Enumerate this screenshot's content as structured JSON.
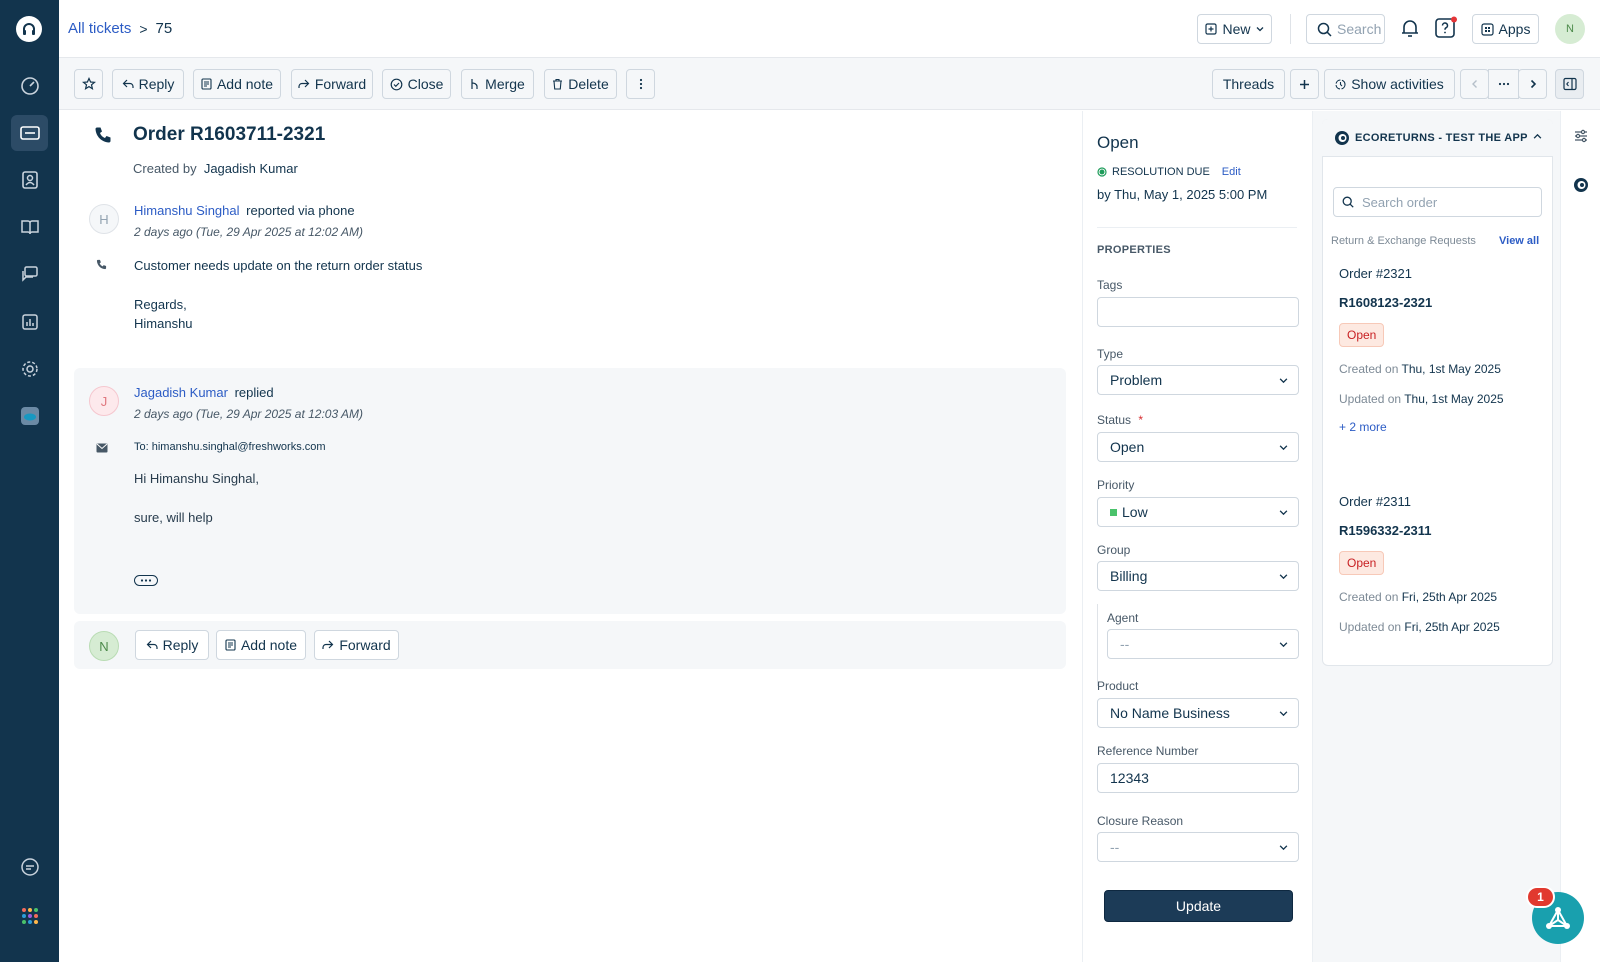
{
  "breadcrumb": {
    "parent": "All tickets",
    "separator": ">",
    "current": "75"
  },
  "topbar": {
    "new_label": "New",
    "search_label": "Search",
    "apps_label": "Apps",
    "user_initial": "N"
  },
  "toolbar": {
    "reply": "Reply",
    "add_note": "Add note",
    "forward": "Forward",
    "close": "Close",
    "merge": "Merge",
    "delete": "Delete",
    "threads": "Threads",
    "show_activities": "Show activities"
  },
  "ticket": {
    "title": "Order R1603711-2321",
    "created_by_label": "Created by",
    "created_by": "Jagadish Kumar"
  },
  "messages": [
    {
      "initial": "H",
      "author": "Himanshu Singhal",
      "action": "reported via phone",
      "time": "2 days ago (Tue, 29 Apr 2025 at 12:02 AM)",
      "body1": "Customer needs update on the return order status",
      "body2": "Regards,",
      "body3": "Himanshu"
    },
    {
      "initial": "J",
      "author": "Jagadish Kumar",
      "action": "replied",
      "time": "2 days ago (Tue, 29 Apr 2025 at 12:03 AM)",
      "to_label": "To:",
      "to": "himanshu.singhal@freshworks.com",
      "body1": "Hi Himanshu Singhal,",
      "body2": "sure, will help"
    }
  ],
  "reply_bar": {
    "initial": "N",
    "reply": "Reply",
    "add_note": "Add note",
    "forward": "Forward"
  },
  "properties": {
    "status_title": "Open",
    "resolution_label": "RESOLUTION DUE",
    "edit_label": "Edit",
    "due": "by Thu, May 1, 2025 5:00 PM",
    "section": "PROPERTIES",
    "tags_label": "Tags",
    "type_label": "Type",
    "type_value": "Problem",
    "status_label": "Status",
    "status_required": "*",
    "status_value": "Open",
    "priority_label": "Priority",
    "priority_value": "Low",
    "group_label": "Group",
    "group_value": "Billing",
    "agent_label": "Agent",
    "agent_value": "--",
    "product_label": "Product",
    "product_value": "No Name Business",
    "ref_label": "Reference Number",
    "ref_value": "12343",
    "closure_label": "Closure Reason",
    "closure_value": "--",
    "update_label": "Update",
    "priority_color": "#4ac26b"
  },
  "app": {
    "title": "ECORETURNS - TEST THE APP",
    "search_placeholder": "Search order",
    "section": "Return & Exchange Requests",
    "view_all": "View all",
    "orders": [
      {
        "order": "Order #2321",
        "id": "R1608123-2321",
        "status": "Open",
        "created_label": "Created on",
        "created": "Thu, 1st May 2025",
        "updated_label": "Updated on",
        "updated": "Thu, 1st May 2025",
        "more": "+ 2 more"
      },
      {
        "order": "Order #2311",
        "id": "R1596332-2311",
        "status": "Open",
        "created_label": "Created on",
        "created": "Fri, 25th Apr 2025",
        "updated_label": "Updated on",
        "updated": "Fri, 25th Apr 2025"
      }
    ]
  },
  "notification_count": "1"
}
